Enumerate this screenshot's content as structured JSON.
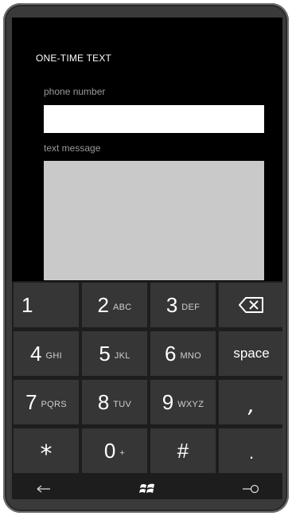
{
  "app": {
    "title": "ONE-TIME TEXT"
  },
  "form": {
    "phone_label": "phone number",
    "phone_value": "",
    "message_label": "text message",
    "message_value": ""
  },
  "keypad": {
    "rows": [
      [
        {
          "main": "1",
          "sub": ""
        },
        {
          "main": "2",
          "sub": "ABC"
        },
        {
          "main": "3",
          "sub": "DEF"
        },
        {
          "main": "",
          "sub": "",
          "icon": "backspace-icon"
        }
      ],
      [
        {
          "main": "4",
          "sub": "GHI"
        },
        {
          "main": "5",
          "sub": "JKL"
        },
        {
          "main": "6",
          "sub": "MNO"
        },
        {
          "main": "space",
          "sub": ""
        }
      ],
      [
        {
          "main": "7",
          "sub": "PQRS"
        },
        {
          "main": "8",
          "sub": "TUV"
        },
        {
          "main": "9",
          "sub": "WXYZ"
        },
        {
          "main": ",",
          "sub": ""
        }
      ],
      [
        {
          "main": "*",
          "sub": ""
        },
        {
          "main": "0",
          "sub": "+"
        },
        {
          "main": "#",
          "sub": ""
        },
        {
          "main": ".",
          "sub": ""
        }
      ]
    ]
  },
  "nav": {
    "icons": [
      "back-arrow-icon",
      "windows-logo-icon",
      "search-icon"
    ]
  },
  "colors": {
    "background": "#000000",
    "key": "#363636",
    "message_box": "#c9c9c9",
    "label": "#9a9a9a"
  }
}
